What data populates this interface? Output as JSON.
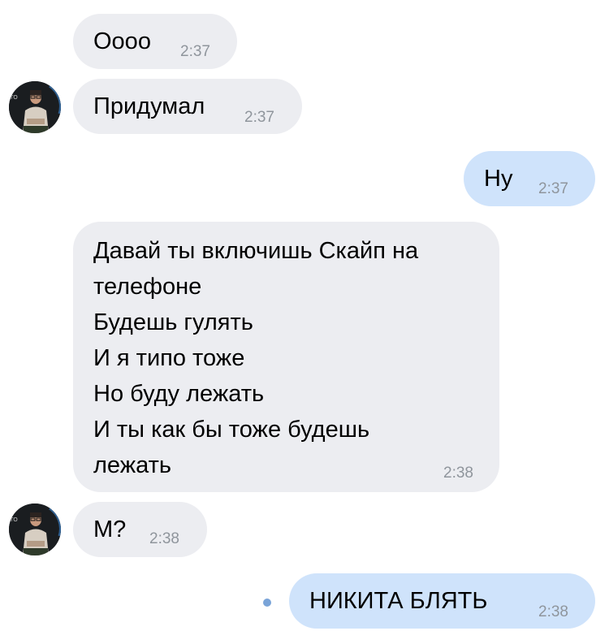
{
  "chat": {
    "messages": [
      {
        "direction": "incoming",
        "lines": [
          "Оооо"
        ],
        "time": "2:37"
      },
      {
        "direction": "incoming",
        "lines": [
          "Придумал"
        ],
        "time": "2:37"
      },
      {
        "direction": "outgoing",
        "lines": [
          "Ну"
        ],
        "time": "2:37"
      },
      {
        "direction": "incoming",
        "lines": [
          "Давай ты включишь Скайп на",
          "телефоне",
          "Будешь гулять",
          "И я типо тоже",
          "Но буду лежать",
          "И ты как бы тоже будешь",
          "лежать"
        ],
        "time": "2:38"
      },
      {
        "direction": "incoming",
        "lines": [
          "М?"
        ],
        "time": "2:38"
      },
      {
        "direction": "outgoing",
        "lines": [
          "НИКИТА БЛЯТЬ"
        ],
        "time": "2:38",
        "unread": true
      }
    ]
  },
  "avatar": {
    "sign_text": "ТО",
    "icon": "user-avatar-icon"
  },
  "colors": {
    "incoming_bubble": "#ecedf1",
    "outgoing_bubble": "#cfe3fb",
    "time_text": "#8f959c",
    "unread_dot": "#7aa4d8"
  }
}
